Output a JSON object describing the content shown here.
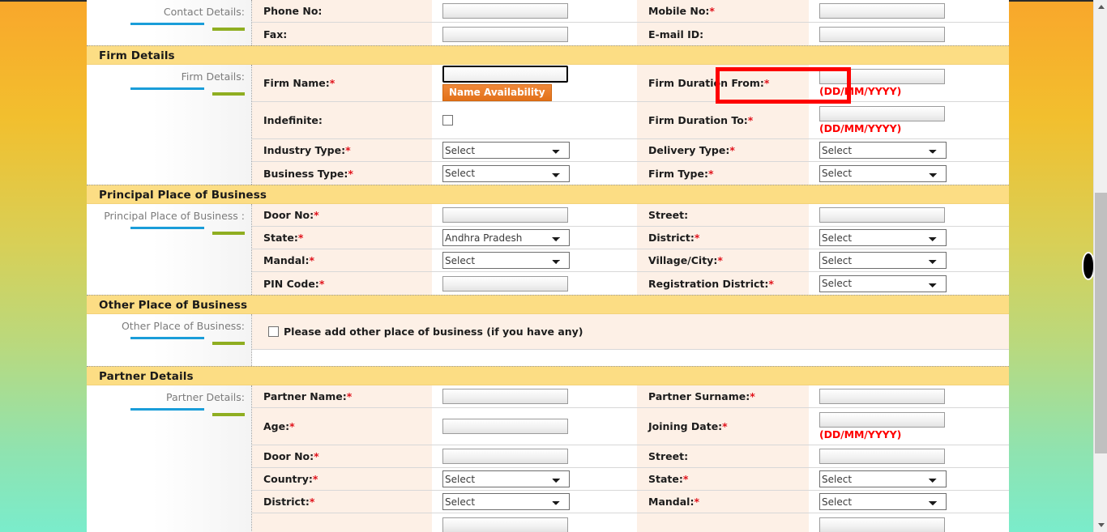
{
  "window": {
    "scrollbar": {
      "thumb_label": "vertical-scroll-thumb",
      "up_arrow": "▲",
      "down_arrow": "▼"
    }
  },
  "colors": {
    "section_header_bg": "#fcdd84",
    "label_cell_bg": "#fdf0e6",
    "required_asterisk": "#e0121b",
    "hint_red": "#fe0000",
    "annotation_red": "#fe0000",
    "button_orange": "#e2711a",
    "accent_blue_bar": "#1a9dd9",
    "accent_green_bar": "#8fae21",
    "page_gradient_top": "#f9a72b",
    "page_gradient_bottom": "#7aeccb"
  },
  "common": {
    "select_placeholder": "Select",
    "date_format_hint": "(DD/MM/YYYY)",
    "required_mark": "*"
  },
  "sections": [
    {
      "id": "contact-details",
      "header": null,
      "side_label": "Contact Details:",
      "rows": [
        {
          "left": {
            "label": "Phone No:",
            "required": false,
            "control": "text",
            "value": ""
          },
          "right": {
            "label": "Mobile No:",
            "required": true,
            "control": "text",
            "value": ""
          }
        },
        {
          "left": {
            "label": "Fax:",
            "required": false,
            "control": "text",
            "value": ""
          },
          "right": {
            "label": "E-mail ID:",
            "required": false,
            "control": "text",
            "value": ""
          }
        }
      ]
    },
    {
      "id": "firm-details",
      "header": "Firm Details",
      "side_label": "Firm Details:",
      "rows": [
        {
          "left": {
            "label": "Firm Name:",
            "required": true,
            "control": "text-with-button",
            "value": "",
            "focused": true,
            "button_label": "Name Availability"
          },
          "right": {
            "label": "Firm Duration From:",
            "required": true,
            "control": "text",
            "value": "",
            "hint": "(DD/MM/YYYY)",
            "annotated": true
          }
        },
        {
          "left": {
            "label": "Indefinite:",
            "required": false,
            "control": "checkbox",
            "checked": false
          },
          "right": {
            "label": "Firm Duration To:",
            "required": true,
            "control": "text",
            "value": "",
            "hint": "(DD/MM/YYYY)"
          }
        },
        {
          "left": {
            "label": "Industry Type:",
            "required": true,
            "control": "select",
            "value": "Select"
          },
          "right": {
            "label": "Delivery Type:",
            "required": true,
            "control": "select",
            "value": "Select"
          }
        },
        {
          "left": {
            "label": "Business Type:",
            "required": true,
            "control": "select",
            "value": "Select"
          },
          "right": {
            "label": "Firm Type:",
            "required": true,
            "control": "select",
            "value": "Select"
          }
        }
      ]
    },
    {
      "id": "principal-place-of-business",
      "header": "Principal Place of Business",
      "side_label": "Principal Place of Business :",
      "rows": [
        {
          "left": {
            "label": "Door No:",
            "required": true,
            "control": "text",
            "value": ""
          },
          "right": {
            "label": "Street:",
            "required": false,
            "control": "text",
            "value": ""
          }
        },
        {
          "left": {
            "label": "State:",
            "required": true,
            "control": "select",
            "value": "Andhra Pradesh"
          },
          "right": {
            "label": "District:",
            "required": true,
            "control": "select",
            "value": "Select"
          }
        },
        {
          "left": {
            "label": "Mandal:",
            "required": true,
            "control": "select",
            "value": "Select"
          },
          "right": {
            "label": "Village/City:",
            "required": true,
            "control": "select",
            "value": "Select"
          }
        },
        {
          "left": {
            "label": "PIN Code:",
            "required": true,
            "control": "text",
            "value": ""
          },
          "right": {
            "label": "Registration District:",
            "required": true,
            "control": "select",
            "value": "Select"
          }
        }
      ]
    },
    {
      "id": "other-place-of-business",
      "header": "Other Place of Business",
      "side_label": "Other Place of Business:",
      "checkbox_row": {
        "label": "Please add other place of business (if you have any)",
        "checked": false
      }
    },
    {
      "id": "partner-details",
      "header": "Partner Details",
      "side_label": "Partner Details:",
      "rows": [
        {
          "left": {
            "label": "Partner Name:",
            "required": true,
            "control": "text",
            "value": ""
          },
          "right": {
            "label": "Partner Surname:",
            "required": true,
            "control": "text",
            "value": ""
          }
        },
        {
          "left": {
            "label": "Age:",
            "required": true,
            "control": "text",
            "value": ""
          },
          "right": {
            "label": "Joining Date:",
            "required": true,
            "control": "text",
            "value": "",
            "hint": "(DD/MM/YYYY)"
          }
        },
        {
          "left": {
            "label": "Door No:",
            "required": true,
            "control": "text",
            "value": ""
          },
          "right": {
            "label": "Street:",
            "required": false,
            "control": "text",
            "value": ""
          }
        },
        {
          "left": {
            "label": "Country:",
            "required": true,
            "control": "select",
            "value": "Select"
          },
          "right": {
            "label": "State:",
            "required": true,
            "control": "select",
            "value": "Select"
          }
        },
        {
          "left": {
            "label": "District:",
            "required": true,
            "control": "select",
            "value": "Select"
          },
          "right": {
            "label": "Mandal:",
            "required": true,
            "control": "select",
            "value": "Select"
          }
        },
        {
          "left": {
            "label": "",
            "required": false,
            "control": "text",
            "value": ""
          },
          "right": {
            "label": "",
            "required": false,
            "control": "text",
            "value": ""
          }
        }
      ]
    }
  ]
}
